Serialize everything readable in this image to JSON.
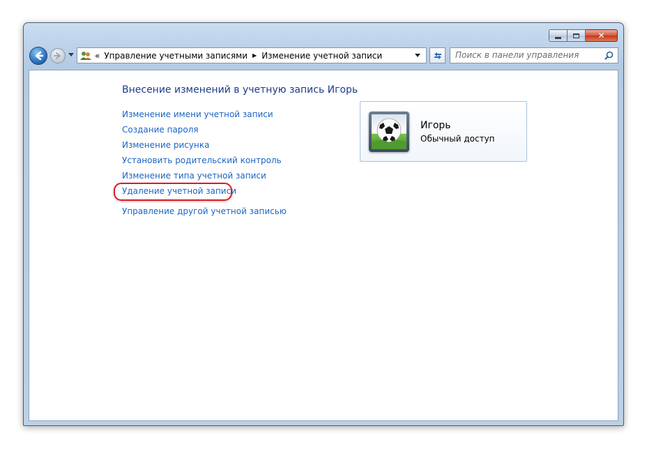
{
  "address_bar": {
    "overflow_chevron": "«",
    "crumb_1": "Управление учетными записями",
    "separator": "▶",
    "crumb_2": "Изменение учетной записи"
  },
  "search": {
    "placeholder": "Поиск в панели управления"
  },
  "main": {
    "heading": "Внесение изменений в учетную запись Игорь",
    "tasks": [
      {
        "label": "Изменение имени учетной записи"
      },
      {
        "label": "Создание пароля"
      },
      {
        "label": "Изменение рисунка"
      },
      {
        "label": "Установить родительский контроль"
      },
      {
        "label": "Изменение типа учетной записи"
      },
      {
        "label": "Удаление учетной записи"
      }
    ],
    "other_account_link": "Управление другой учетной записью"
  },
  "user": {
    "name": "Игорь",
    "account_type": "Обычный доступ",
    "avatar_icon": "soccer-ball-icon"
  },
  "colors": {
    "link": "#1b64c4",
    "heading": "#1e3b8a",
    "highlight": "#d61f27"
  }
}
